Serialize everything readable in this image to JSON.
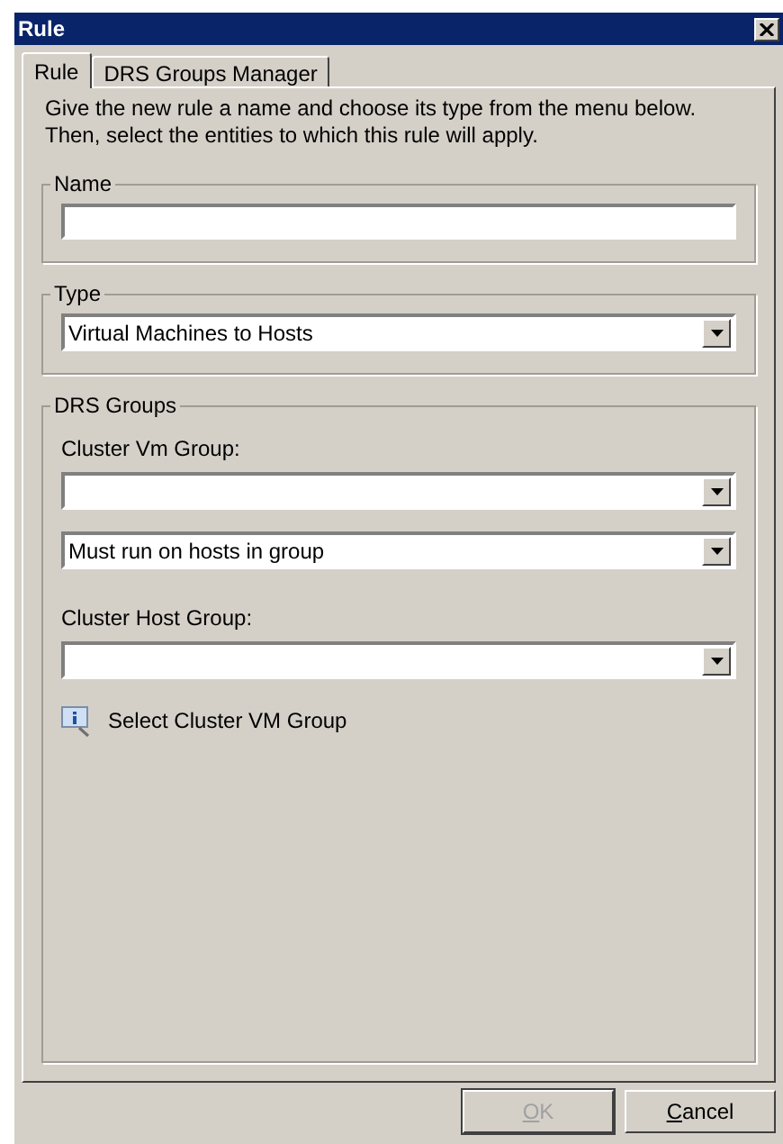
{
  "window": {
    "title": "Rule"
  },
  "tabs": [
    {
      "label": "Rule",
      "selected": true
    },
    {
      "label": "DRS Groups Manager",
      "selected": false
    }
  ],
  "intro_lines": [
    "Give the new rule a name and choose its type from the menu below.",
    "Then, select the entities to which this rule will apply."
  ],
  "name_group": {
    "legend": "Name"
  },
  "type_group": {
    "legend": "Type",
    "value": "Virtual Machines to Hosts"
  },
  "drs_groups": {
    "legend": "DRS Groups",
    "fields": [
      {
        "kind": "labeled_combo",
        "label": "Cluster Vm Group:"
      },
      {
        "kind": "combo",
        "value": "Must run on hosts in group"
      },
      {
        "kind": "labeled_combo",
        "label": "Cluster Host Group:"
      }
    ],
    "link": "Select Cluster VM Group"
  },
  "buttons": [
    {
      "label": "OK",
      "disabled": true
    },
    {
      "label": "Cancel",
      "disabled": false
    }
  ]
}
